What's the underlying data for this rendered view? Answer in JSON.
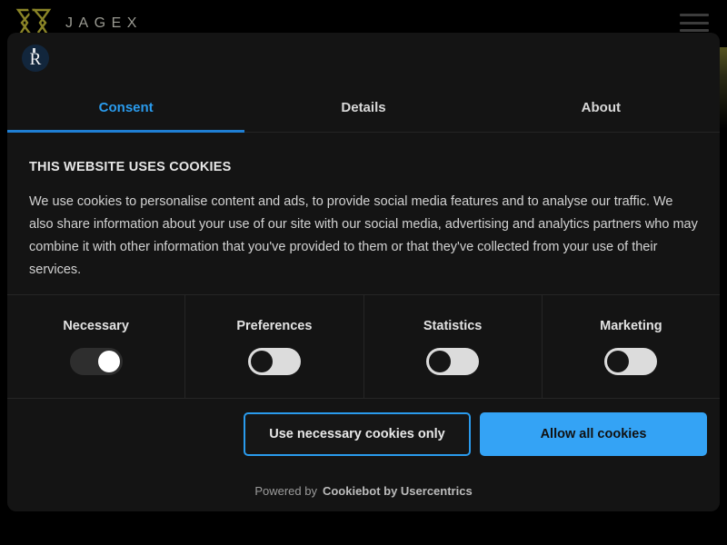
{
  "site_header": {
    "brand_name": "JAGEX",
    "logo_icon": "jagex-sigil-icon",
    "menu_icon": "hamburger-menu-icon"
  },
  "cookie_dialog": {
    "logo_icon": "cookiebot-r-logo-icon",
    "tabs": [
      {
        "label": "Consent",
        "active": true
      },
      {
        "label": "Details",
        "active": false
      },
      {
        "label": "About",
        "active": false
      }
    ],
    "title": "THIS WEBSITE USES COOKIES",
    "description": "We use cookies to personalise content and ads, to provide social media features and to analyse our traffic. We also share information about your use of our site with our social media, advertising and analytics partners who may combine it with other information that you've provided to them or that they've collected from your use of their services.",
    "categories": [
      {
        "label": "Necessary",
        "state": "on"
      },
      {
        "label": "Preferences",
        "state": "off"
      },
      {
        "label": "Statistics",
        "state": "off"
      },
      {
        "label": "Marketing",
        "state": "off"
      }
    ],
    "buttons": {
      "secondary_label": "Use necessary cookies only",
      "primary_label": "Allow all cookies"
    },
    "footer": {
      "powered_by": "Powered by",
      "provider": "Cookiebot by Usercentrics"
    }
  },
  "colors": {
    "page_background": "#000000",
    "dialog_background": "#141414",
    "accent_blue": "#34a3f5",
    "tab_active": "#2a9bed",
    "tab_underline": "#1f7fd4",
    "brand_gold": "#8a8427",
    "switch_on_track": "#2e2e2e",
    "switch_off_track": "#dcdcdc"
  }
}
